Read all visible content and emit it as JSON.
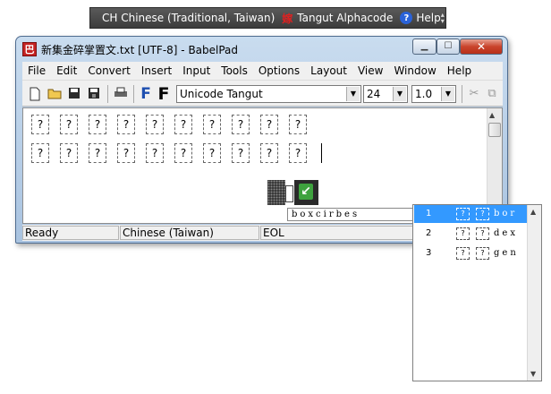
{
  "langbar": {
    "language": "CH Chinese (Traditional, Taiwan)",
    "ime_icon": "嫁",
    "ime": "Tangut Alphacode",
    "help": "Help",
    "help_glyph": "?"
  },
  "window": {
    "title": "新集金碎掌置文.txt [UTF-8] - BabelPad",
    "app_icon": "巴",
    "close_glyph": "✕",
    "min_glyph": "▁",
    "max_glyph": "☐"
  },
  "menu": [
    "File",
    "Edit",
    "Convert",
    "Insert",
    "Input",
    "Tools",
    "Options",
    "Layout",
    "View",
    "Window",
    "Help"
  ],
  "toolbar": {
    "font": "Unicode Tangut",
    "size": "24",
    "spacing": "1.0"
  },
  "editor": {
    "rows": [
      [
        "?",
        "?",
        "?",
        "?",
        "?",
        "?",
        "?",
        "?",
        "?",
        "?"
      ],
      [
        "?",
        "?",
        "?",
        "?",
        "?",
        "?",
        "?",
        "?",
        "?",
        "?"
      ]
    ]
  },
  "status": {
    "state": "Ready",
    "language": "Chinese (Taiwan)",
    "eol": "EOL"
  },
  "ime": {
    "composition": "boxcirbes",
    "candidates": [
      {
        "num": "1",
        "g1": "?",
        "g2": "?",
        "latin": "bor",
        "selected": true
      },
      {
        "num": "2",
        "g1": "?",
        "g2": "?",
        "latin": "dex",
        "selected": false
      },
      {
        "num": "3",
        "g1": "?",
        "g2": "?",
        "latin": "gen",
        "selected": false
      }
    ]
  }
}
